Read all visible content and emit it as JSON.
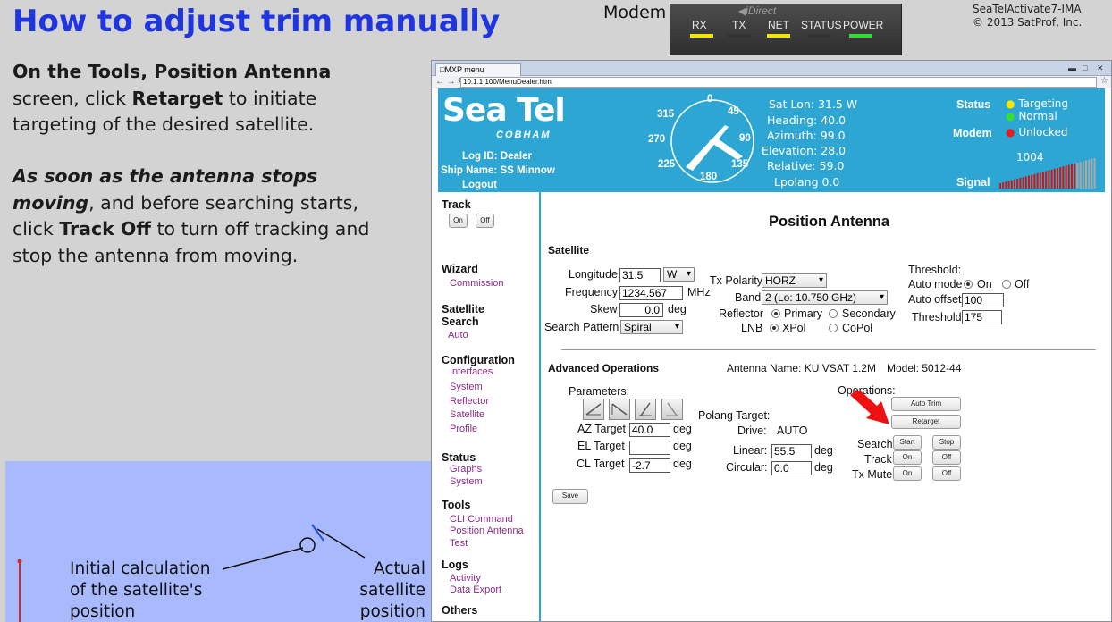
{
  "slide": {
    "title": "How to adjust trim manually",
    "para1": [
      "On the Tools, Position Antenna",
      "screen, click ",
      "Retarget",
      " to initiate",
      "targeting of the desired satellite."
    ],
    "para2": [
      "As soon as the antenna stops",
      "moving",
      ", and before searching starts,",
      "click ",
      "Track Off",
      " to turn off tracking and",
      "stop the antenna from moving."
    ],
    "copyright": [
      "SeaTelActivate7-IMA",
      "© 2013 SatProf, Inc."
    ]
  },
  "modem": {
    "label": "Modem",
    "brand": "iDirect",
    "leds": [
      {
        "name": "RX",
        "color": "#f3e500"
      },
      {
        "name": "TX",
        "color": "#333333"
      },
      {
        "name": "NET",
        "color": "#f3e500"
      },
      {
        "name": "STATUS",
        "color": "#333333"
      },
      {
        "name": "POWER",
        "color": "#2fe02f"
      }
    ]
  },
  "diagram": {
    "initial_label": [
      "Initial calculation",
      "of the satellite's",
      "position"
    ],
    "actual_label": [
      "Actual",
      "satellite",
      "position"
    ]
  },
  "browser": {
    "tab_title": "MXP menu",
    "url": "10.1.1.100/MenuDealer.html"
  },
  "header": {
    "logo": "Sea Tel",
    "logo_sub": "COBHAM",
    "log_id": "Log ID: Dealer",
    "ship_name": "Ship Name: SS Minnow",
    "logout": "Logout",
    "compass": {
      "n": "0",
      "ne": "45",
      "e": "90",
      "se": "135",
      "s": "180",
      "sw": "225",
      "w": "270",
      "nw": "315"
    },
    "sat_lon": "Sat Lon: 31.5 W",
    "heading": "Heading: 40.0",
    "azimuth": "Azimuth: 99.0",
    "elevation": "Elevation: 28.0",
    "relative": "Relative: 59.0",
    "lpolang": "Lpolang  0.0",
    "status_label": "Status",
    "status_items": [
      {
        "text": "Targeting",
        "color": "#f4e800"
      },
      {
        "text": "Normal",
        "color": "#33e033"
      }
    ],
    "modem_label": "Modem",
    "modem_status": {
      "text": "Unlocked",
      "color": "#e02020"
    },
    "signal_value": "1004",
    "signal_label": "Signal"
  },
  "sidebar": {
    "track": "Track",
    "on": "On",
    "off": "Off",
    "wizard": "Wizard",
    "commission": "Commission",
    "satellite_search": [
      "Satellite",
      "Search"
    ],
    "auto": "Auto",
    "configuration": "Configuration",
    "config_links": [
      "Interfaces",
      "System",
      "Reflector",
      "Satellite",
      "Profile"
    ],
    "status": "Status",
    "status_links": [
      "Graphs",
      "System"
    ],
    "tools": "Tools",
    "tools_links": [
      "CLI Command",
      "Position Antenna",
      "Test"
    ],
    "logs": "Logs",
    "logs_links": [
      "Activity",
      "Data Export"
    ],
    "others": "Others"
  },
  "page": {
    "title": "Position Antenna",
    "satellite_heading": "Satellite",
    "longitude_label": "Longitude",
    "longitude_value": "31.5",
    "hemisphere": "W",
    "frequency_label": "Frequency",
    "frequency_value": "1234.567",
    "mhz": "MHz",
    "skew_label": "Skew",
    "skew_value": "0.0",
    "deg": "deg",
    "search_pattern_label": "Search Pattern",
    "search_pattern_value": "Spiral",
    "tx_polarity_label": "Tx Polarity",
    "tx_polarity_value": "HORZ",
    "band_label": "Band",
    "band_value": "2 (Lo: 10.750 GHz)",
    "reflector_label": "Reflector",
    "primary": "Primary",
    "secondary": "Secondary",
    "lnb_label": "LNB",
    "xpol": "XPol",
    "copol": "CoPol",
    "threshold_heading": "Threshold:",
    "auto_mode_label": "Auto mode",
    "on": "On",
    "off": "Off",
    "auto_offset_label": "Auto offset",
    "auto_offset_value": "100",
    "threshold_label": "Threshold",
    "threshold_value": "175",
    "advanced_heading": "Advanced Operations",
    "antenna_name": "Antenna Name: KU VSAT 1.2M",
    "model": "Model: 5012-44",
    "parameters_label": "Parameters:",
    "az_target_label": "AZ Target",
    "az_target_value": "40.0",
    "el_target_label": "EL Target",
    "el_target_value": "",
    "cl_target_label": "CL Target",
    "cl_target_value": "-2.7",
    "polang_target_label": "Polang Target:",
    "drive_label": "Drive:",
    "drive_value": "AUTO",
    "linear_label": "Linear:",
    "linear_value": "55.5",
    "circular_label": "Circular:",
    "circular_value": "0.0",
    "operations_label": "Operations:",
    "auto_trim": "Auto Trim",
    "retarget": "Retarget",
    "search_label": "Search",
    "start": "Start",
    "stop": "Stop",
    "track_label": "Track",
    "tx_mute_label": "Tx Mute",
    "save": "Save",
    "arrow_color": "#ee1111"
  }
}
